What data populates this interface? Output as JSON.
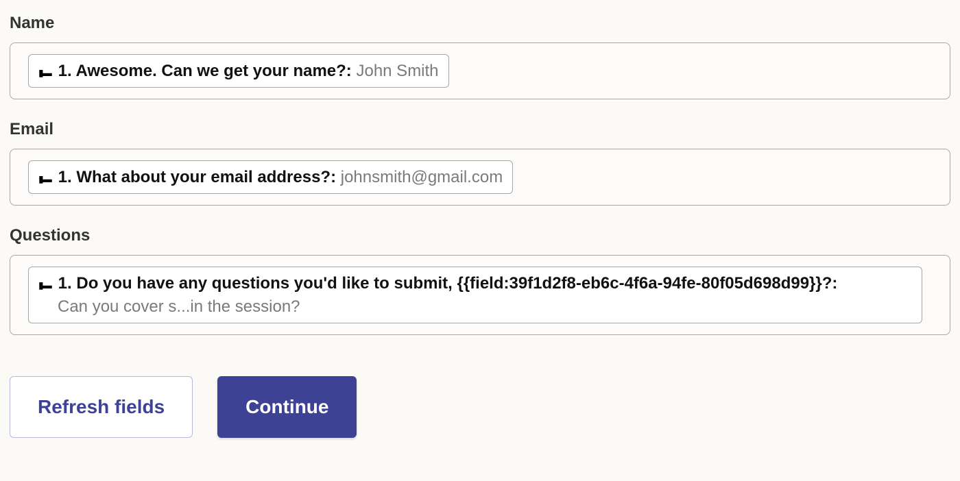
{
  "fields": {
    "name": {
      "label": "Name",
      "chip_question": "1. Awesome. Can we get your name?: ",
      "chip_value": "John Smith"
    },
    "email": {
      "label": "Email",
      "chip_question": "1. What about your email address?: ",
      "chip_value": "johnsmith@gmail.com"
    },
    "questions": {
      "label": "Questions",
      "chip_question": "1. Do you have any questions you'd like to submit, {{field:39f1d2f8-eb6c-4f6a-94fe-80f05d698d99}}?:",
      "chip_value": "Can you cover s...in the session?"
    }
  },
  "buttons": {
    "refresh": "Refresh fields",
    "continue": "Continue"
  },
  "icons": {
    "chip": "▮▬"
  }
}
